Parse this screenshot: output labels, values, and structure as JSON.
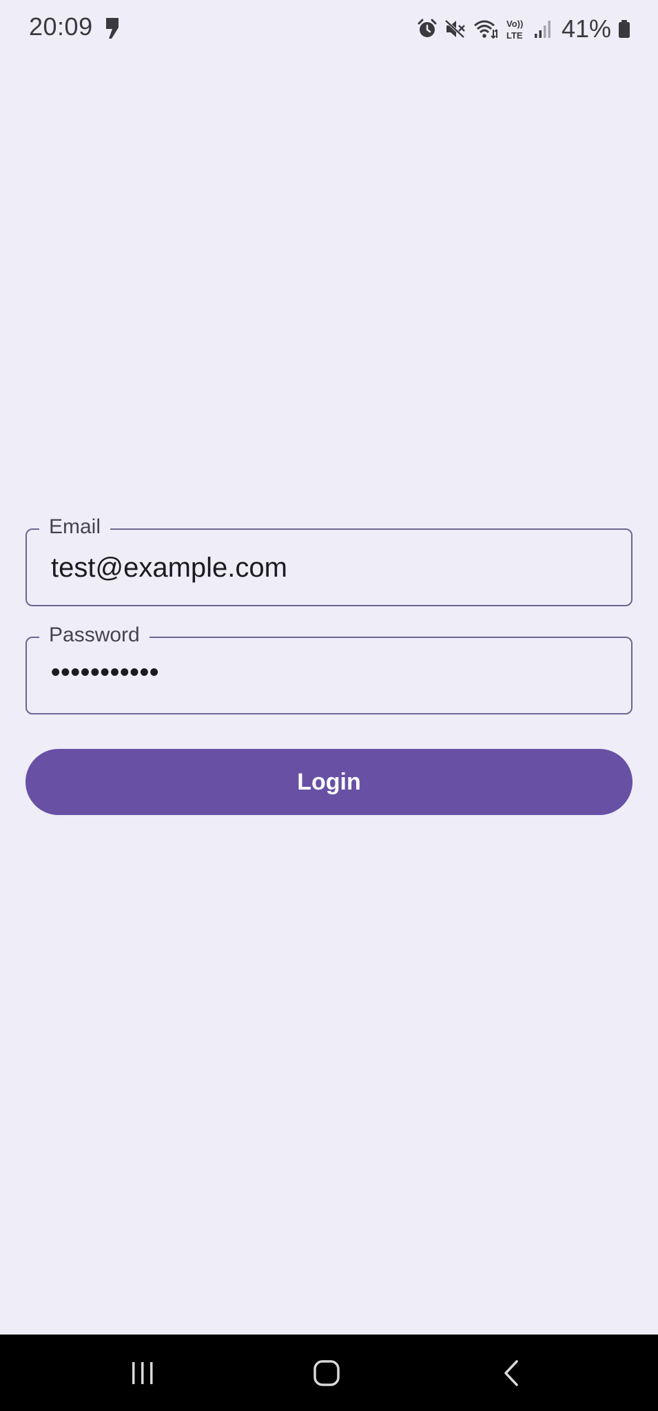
{
  "status_bar": {
    "time": "20:09",
    "battery_percent": "41%",
    "icons": [
      "notification-icon",
      "alarm-icon",
      "mute-icon",
      "wifi-icon",
      "volte-icon",
      "signal-icon",
      "battery-icon"
    ],
    "volte_line1": "Vo))",
    "volte_line2": "LTE"
  },
  "login_form": {
    "email": {
      "label": "Email",
      "value": "test@example.com"
    },
    "password": {
      "label": "Password",
      "value": "•••••••••••"
    },
    "login_button_label": "Login"
  },
  "colors": {
    "background": "#efedf8",
    "primary": "#6850a5",
    "outline": "#6b6590",
    "nav_bar": "#000000"
  },
  "nav_bar": {
    "buttons": [
      "recents-icon",
      "home-icon",
      "back-icon"
    ]
  }
}
